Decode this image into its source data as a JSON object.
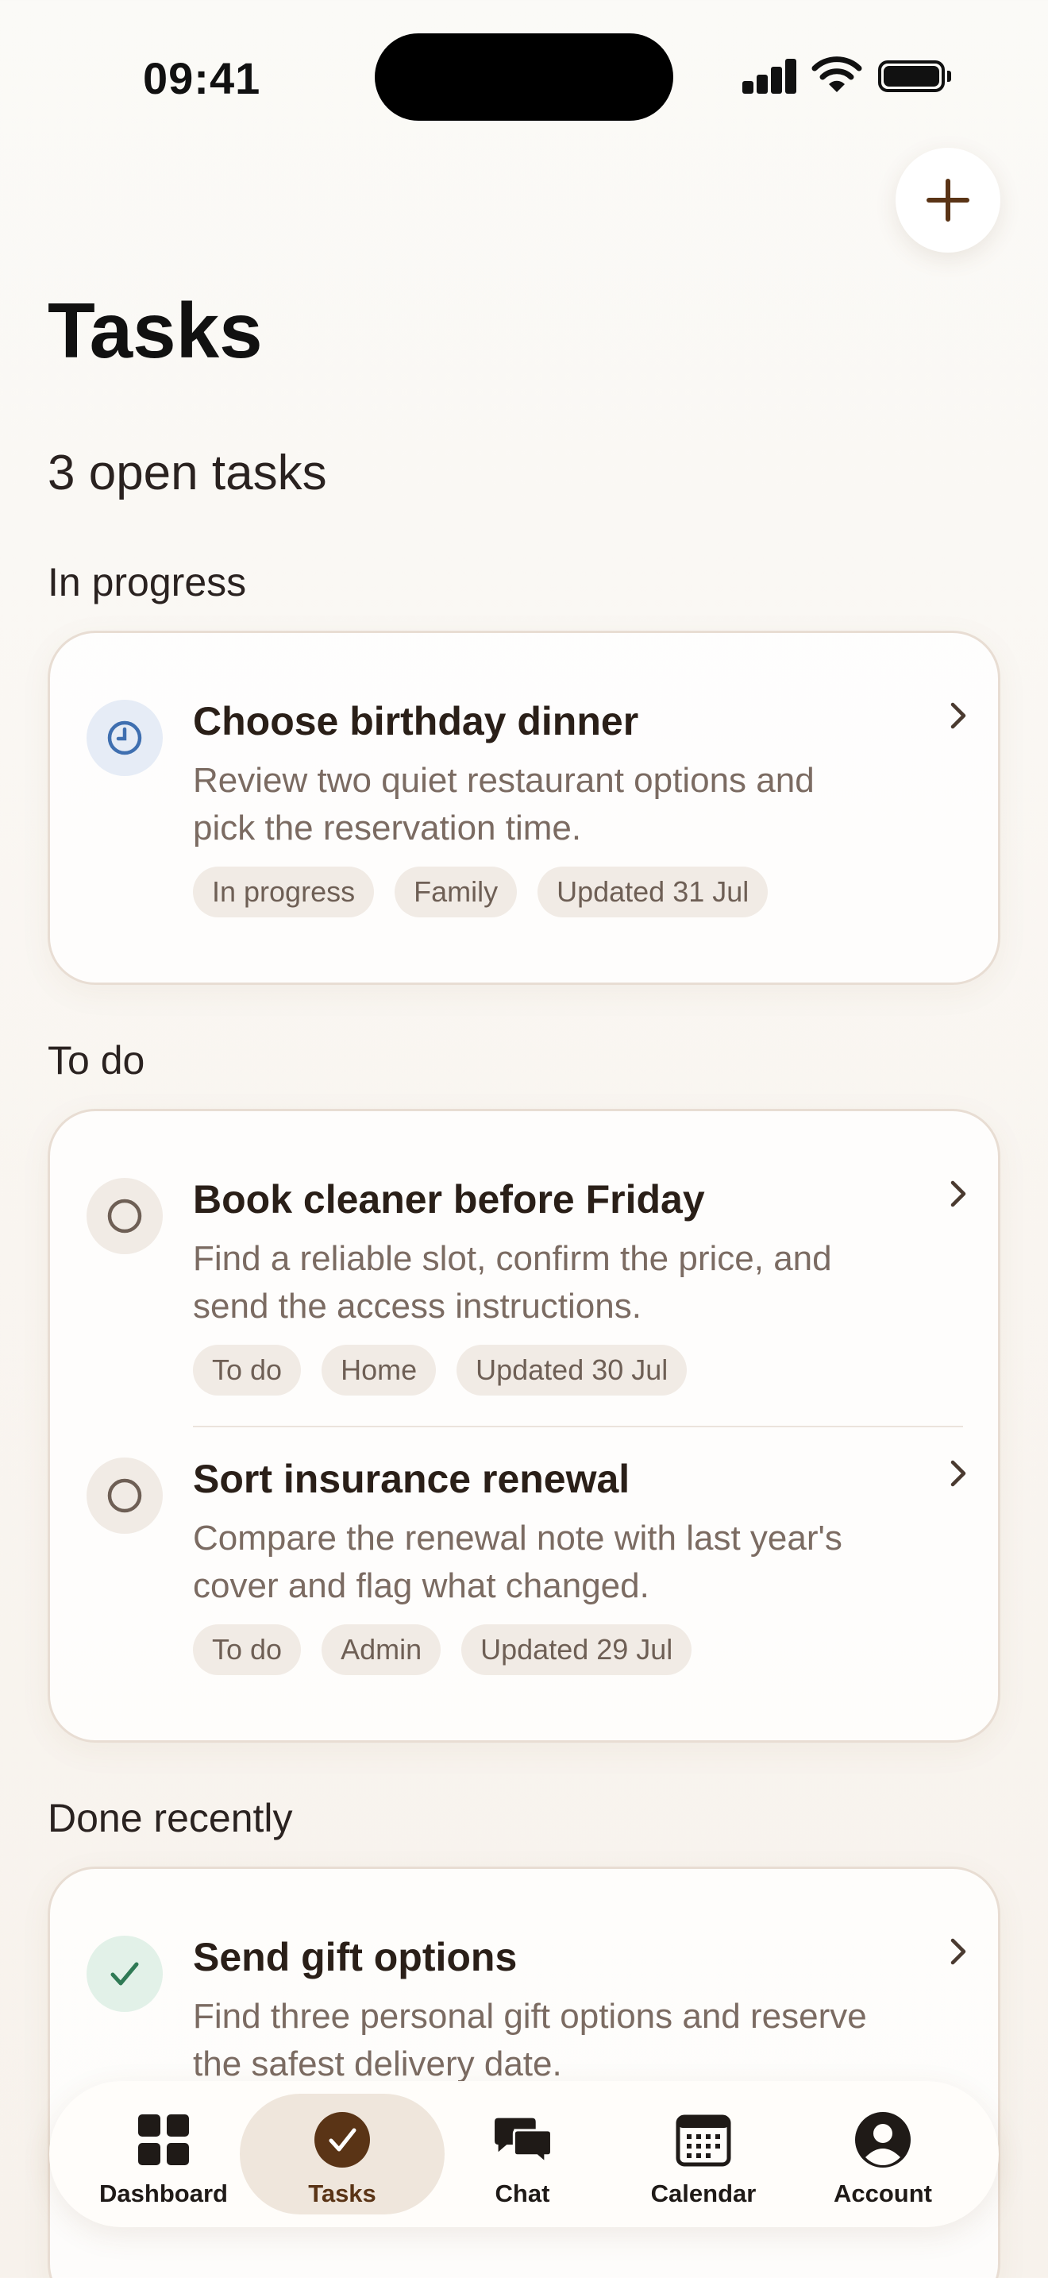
{
  "status_bar": {
    "time": "09:41"
  },
  "header": {
    "title": "Tasks",
    "summary": "3 open tasks"
  },
  "sections": [
    {
      "title": "In progress",
      "tasks": [
        {
          "title": "Choose birthday dinner",
          "description": "Review two quiet restaurant options and pick the reservation time.",
          "tags": [
            "In progress",
            "Family",
            "Updated 31 Jul"
          ],
          "status_icon": "clock-icon"
        }
      ]
    },
    {
      "title": "To do",
      "tasks": [
        {
          "title": "Book cleaner before Friday",
          "description": "Find a reliable slot, confirm the price, and send the access instructions.",
          "tags": [
            "To do",
            "Home",
            "Updated 30 Jul"
          ],
          "status_icon": "circle-icon"
        },
        {
          "title": "Sort insurance renewal",
          "description": "Compare the renewal note with last year's cover and flag what changed.",
          "tags": [
            "To do",
            "Admin",
            "Updated 29 Jul"
          ],
          "status_icon": "circle-icon"
        }
      ]
    },
    {
      "title": "Done recently",
      "tasks": [
        {
          "title": "Send gift options",
          "description": "Find three personal gift options and reserve the safest delivery date.",
          "status_icon": "check-icon"
        }
      ]
    }
  ],
  "tabbar": {
    "items": [
      {
        "label": "Dashboard",
        "icon": "grid-icon"
      },
      {
        "label": "Tasks",
        "icon": "check-circle-icon",
        "active": true
      },
      {
        "label": "Chat",
        "icon": "chat-bubbles-icon"
      },
      {
        "label": "Calendar",
        "icon": "calendar-icon"
      },
      {
        "label": "Account",
        "icon": "person-icon"
      }
    ]
  },
  "colors": {
    "accent": "#5a3416",
    "clock_blue": "#3f6fb0",
    "check_green": "#2f7a55",
    "muted_text": "#7b6b62"
  }
}
